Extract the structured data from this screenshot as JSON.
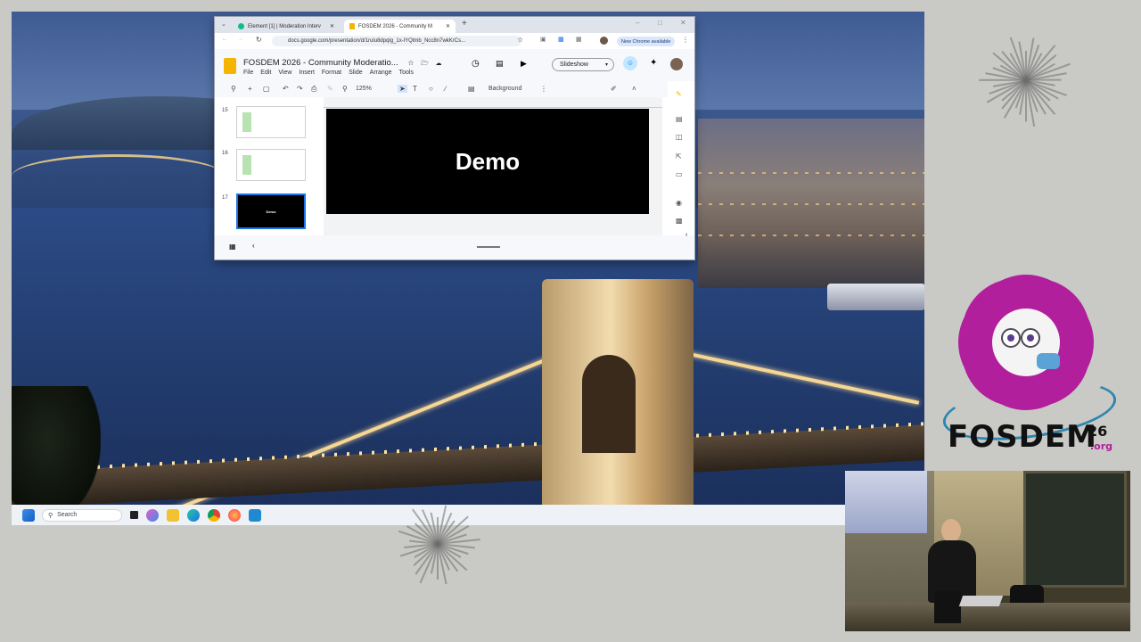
{
  "colors": {
    "accent": "#1a73e8",
    "fosdem_purple": "#b11f9c",
    "fosdem_blue": "#2e86b0",
    "slide_bg": "#000000"
  },
  "browser": {
    "tabs": [
      {
        "label": "Element [1] | Moderation Interv",
        "icon": "element-icon",
        "active": false
      },
      {
        "label": "FOSDEM 2026 - Community M",
        "icon": "slides-icon",
        "active": true
      }
    ],
    "url": "docs.google.com/presentation/d/1rulu8dpqlg_1x-lYQtmb_Ncc8n7wkKrCs...",
    "chrome_badge": "New Chrome available"
  },
  "slides": {
    "title": "FOSDEM 2026 - Community Moderatio...",
    "menus": [
      "File",
      "Edit",
      "View",
      "Insert",
      "Format",
      "Slide",
      "Arrange",
      "Tools"
    ],
    "slideshow_label": "Slideshow",
    "zoom": "125%",
    "background_label": "Background",
    "thumbnails": [
      {
        "num": "15",
        "selected": false
      },
      {
        "num": "16",
        "selected": false
      },
      {
        "num": "17",
        "selected": true,
        "text": "Demo"
      }
    ],
    "current_slide_text": "Demo"
  },
  "taskbar": {
    "search_placeholder": "Search"
  },
  "logo": {
    "name": "FOSDEM",
    "year": "26",
    "tld": ".org"
  }
}
